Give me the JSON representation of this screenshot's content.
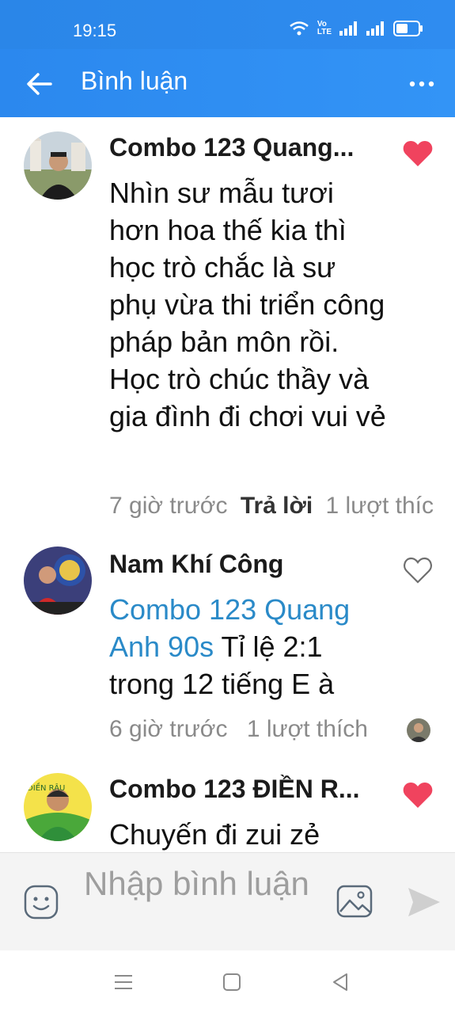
{
  "status_bar": {
    "time": "19:15",
    "network_label": "Vo\nLTE",
    "icons": [
      "wifi-icon",
      "volte-icon",
      "signal-icon",
      "signal-icon",
      "battery-icon"
    ]
  },
  "app_bar": {
    "title": "Bình luận",
    "back_icon": "arrow-left-icon",
    "more_icon": "more-horizontal-icon"
  },
  "comments": [
    {
      "author": "Combo 123 Quang...",
      "text": "Nhìn sư mẫu tươi hơn hoa thế kia thì học trò chắc là sư phụ vừa thi triển công pháp bản môn rồi. Học trò chúc thầy và gia đình đi chơi vui vẻ",
      "time": "7 giờ trước",
      "reply_label": "Trả lời",
      "likes": "1 lượt thích",
      "liked": true
    },
    {
      "author": "Nam Khí Công",
      "mention": "Combo 123 Quang Anh 90s",
      "text": " Tỉ lệ 2:1 trong 12 tiếng E à",
      "time": "6 giờ trước",
      "likes": "1 lượt thích",
      "liked": false
    },
    {
      "author": "Combo 123 ĐIỀN R...",
      "avatar_caption": "ĐIỀN RÂU",
      "text": "Chuyến đi zui zẻ",
      "liked": true
    }
  ],
  "composer": {
    "placeholder": "Nhập bình luận"
  },
  "colors": {
    "app_bar": "#2b88ee",
    "heart_active": "#f0435e",
    "mention": "#2a8ac8"
  }
}
